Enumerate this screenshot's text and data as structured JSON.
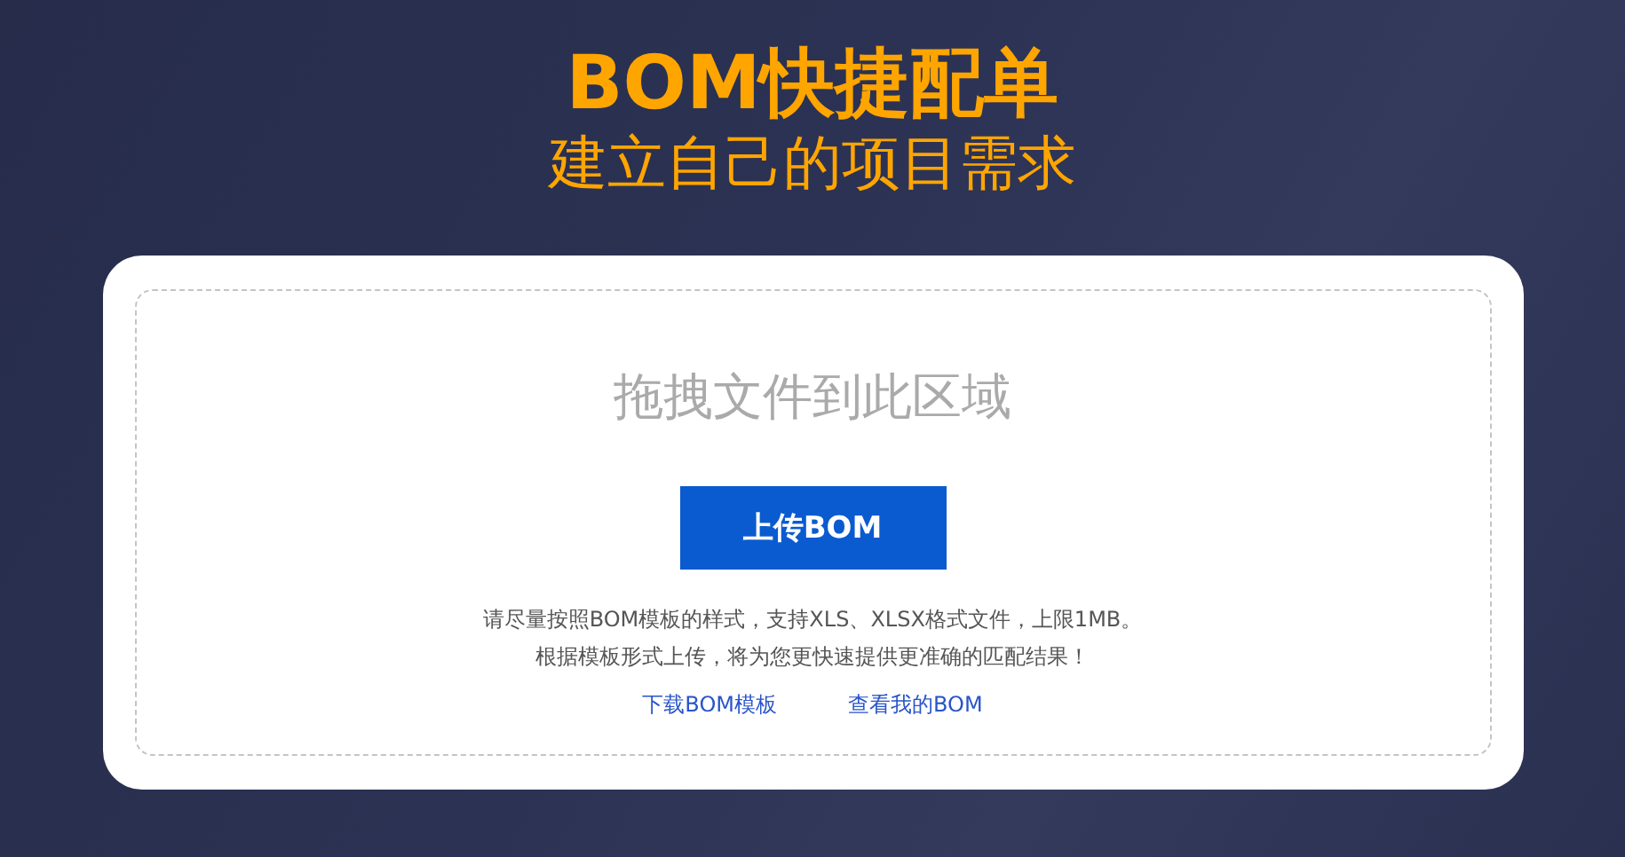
{
  "header": {
    "title": "BOM快捷配单",
    "subtitle": "建立自己的项目需求"
  },
  "upload": {
    "drop_hint": "拖拽文件到此区域",
    "button": "上传BOM",
    "notes": [
      "请尽量按照BOM模板的样式，支持XLS、XLSX格式文件，上限1MB。",
      "根据模板形式上传，将为您更快速提供更准确的匹配结果！"
    ],
    "links": [
      "下载BOM模板",
      "查看我的BOM"
    ]
  }
}
